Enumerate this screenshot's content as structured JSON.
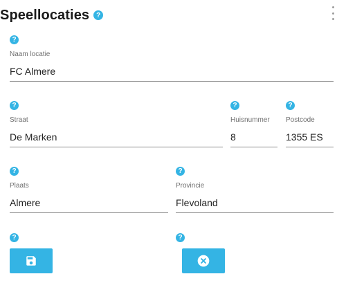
{
  "title": "Speellocaties",
  "help_glyph": "?",
  "fields": {
    "naam": {
      "label": "Naam locatie",
      "value": "FC Almere"
    },
    "straat": {
      "label": "Straat",
      "value": "De Marken"
    },
    "huisnummer": {
      "label": "Huisnummer",
      "value": "8"
    },
    "postcode": {
      "label": "Postcode",
      "value": "1355 ES"
    },
    "plaats": {
      "label": "Plaats",
      "value": "Almere"
    },
    "provincie": {
      "label": "Provincie",
      "value": "Flevoland"
    }
  },
  "buttons": {
    "save_icon": "floppy-disk-icon",
    "cancel_icon": "close-circle-icon"
  },
  "colors": {
    "accent": "#34b4e4",
    "text": "#222222",
    "label": "#6f6f6f"
  }
}
